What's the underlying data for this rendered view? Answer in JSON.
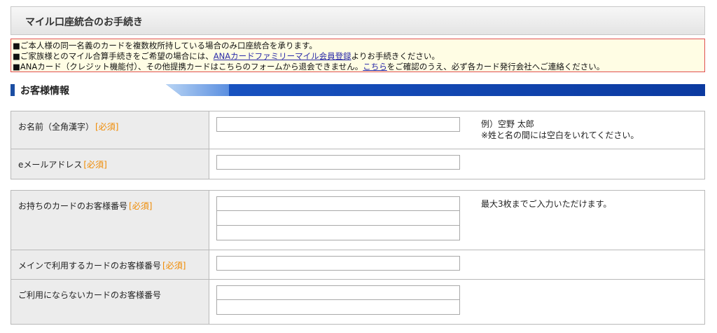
{
  "page": {
    "title": "マイル口座統合のお手続き"
  },
  "notice": {
    "line1": "■ご本人様の同一名義のカードを複数枚所持している場合のみ口座統合を承ります。",
    "line2_pre": "■ご家族様とのマイル合算手続きをご希望の場合には、",
    "line2_link": "ANAカードファミリーマイル会員登録",
    "line2_post": "よりお手続きください。",
    "line3_pre": "■ANAカード（クレジット機能付）、その他提携カードはこちらのフォームから退会できません。",
    "line3_link": "こちら",
    "line3_post": "をご確認のうえ、必ず各カード発行会社へご連絡ください。"
  },
  "section": {
    "title": "お客様情報"
  },
  "required_label": "[必須]",
  "fields": {
    "name": {
      "label": "お名前（全角漢字）",
      "value": "",
      "hint1": "例）空野 太郎",
      "hint2": "※姓と名の間には空白をいれてください。"
    },
    "email": {
      "label": "eメールアドレス",
      "value": ""
    },
    "card_numbers": {
      "label": "お持ちのカードのお客様番号",
      "values": [
        "",
        "",
        ""
      ],
      "hint": "最大3枚までご入力いただけます。"
    },
    "main_card": {
      "label": "メインで利用するカードのお客様番号",
      "value": ""
    },
    "unused_cards": {
      "label": "ご利用にならないカードのお客様番号",
      "values": [
        "",
        ""
      ]
    }
  },
  "colors": {
    "accent": "#1b4ea3",
    "required": "#f08a00",
    "notice_border": "#e05050",
    "notice_bg": "#fffde4",
    "link": "#2a2aa8"
  }
}
